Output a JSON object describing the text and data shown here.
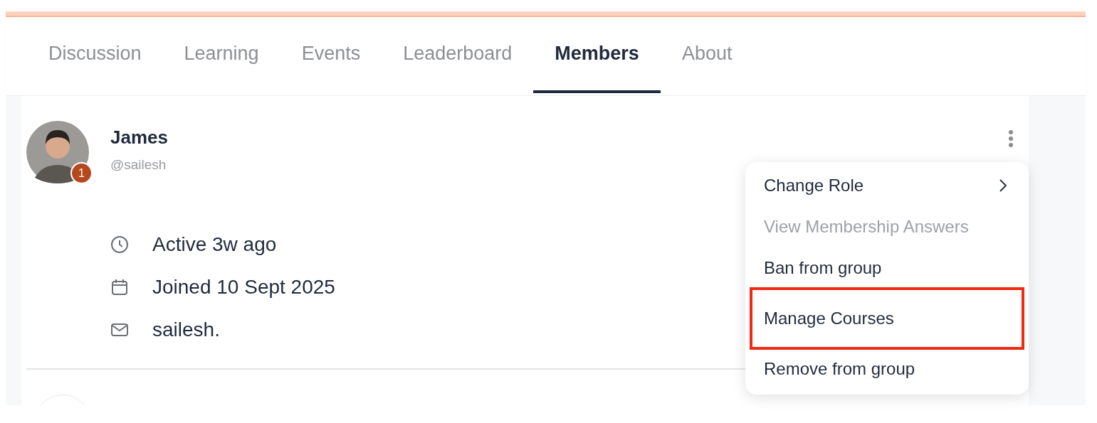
{
  "tabs": [
    {
      "label": "Discussion",
      "selected": false
    },
    {
      "label": "Learning",
      "selected": false
    },
    {
      "label": "Events",
      "selected": false
    },
    {
      "label": "Leaderboard",
      "selected": false
    },
    {
      "label": "Members",
      "selected": true
    },
    {
      "label": "About",
      "selected": false
    }
  ],
  "member": {
    "name": "James",
    "handle": "@sailesh",
    "badge": "1",
    "details": [
      {
        "kind": "clock",
        "text": "Active 3w ago"
      },
      {
        "kind": "calendar",
        "text": "Joined 10 Sept 2025"
      },
      {
        "kind": "mail",
        "text": "sailesh."
      }
    ]
  },
  "menu": {
    "items": [
      {
        "label": "Change Role",
        "kind": "submenu",
        "disabled": false,
        "highlighted": false
      },
      {
        "label": "View Membership Answers",
        "kind": "plain",
        "disabled": true,
        "highlighted": false
      },
      {
        "label": "Ban from group",
        "kind": "plain",
        "disabled": false,
        "highlighted": false
      },
      {
        "label": "Manage Courses",
        "kind": "plain",
        "disabled": false,
        "highlighted": true
      },
      {
        "label": "Remove from group",
        "kind": "plain",
        "disabled": false,
        "highlighted": false
      }
    ]
  }
}
